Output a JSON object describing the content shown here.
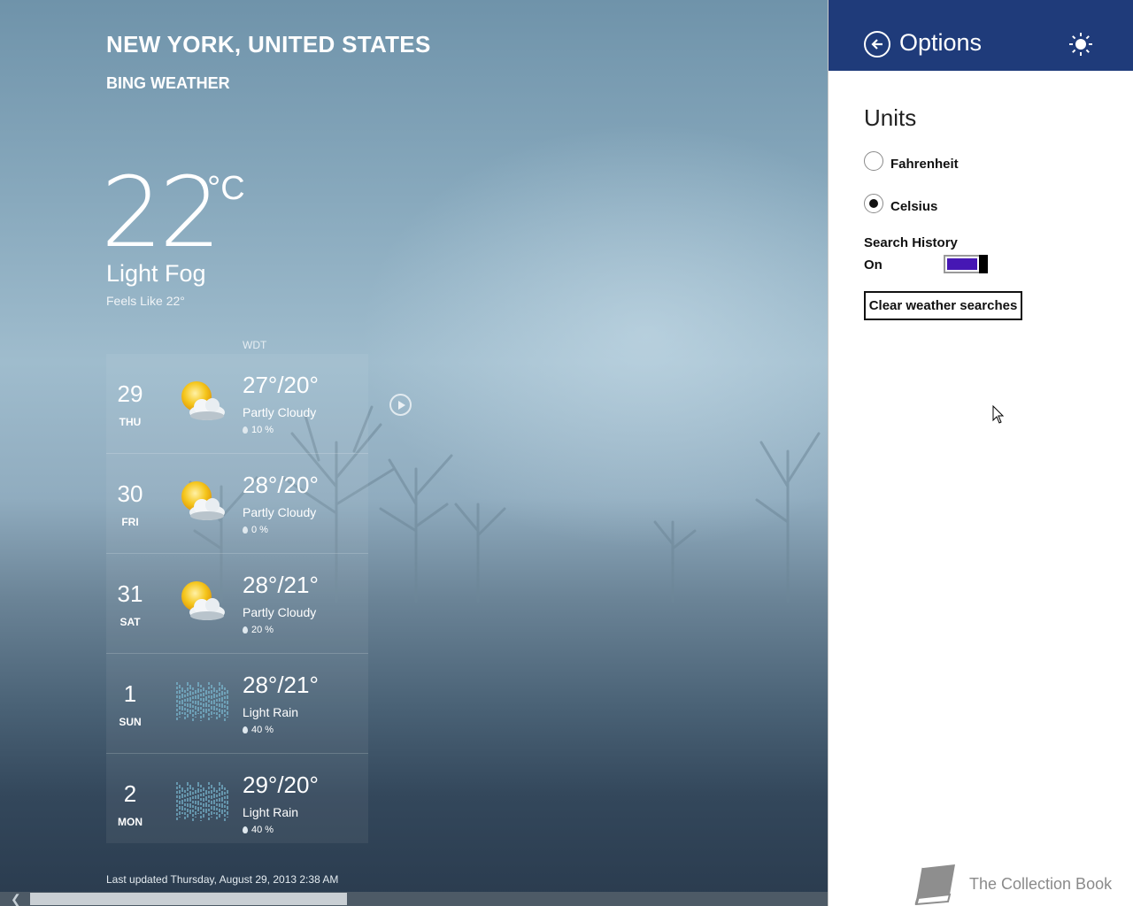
{
  "location": {
    "city": "NEW YORK, UNITED STATES",
    "provider": "BING WEATHER"
  },
  "current": {
    "temp": "22",
    "unit": "°C",
    "condition": "Light Fog",
    "feels_like": "Feels Like 22°"
  },
  "forecast_header": {
    "timezone": "WDT"
  },
  "forecast": [
    {
      "date": "29",
      "dow": "THU",
      "hilo": "27°/20°",
      "condition": "Partly Cloudy",
      "precip": "10 %",
      "icon": "partly-cloudy-icon"
    },
    {
      "date": "30",
      "dow": "FRI",
      "hilo": "28°/20°",
      "condition": "Partly Cloudy",
      "precip": "0 %",
      "icon": "partly-cloudy-icon"
    },
    {
      "date": "31",
      "dow": "SAT",
      "hilo": "28°/21°",
      "condition": "Partly Cloudy",
      "precip": "20 %",
      "icon": "partly-cloudy-icon"
    },
    {
      "date": "1",
      "dow": "SUN",
      "hilo": "28°/21°",
      "condition": "Light Rain",
      "precip": "40 %",
      "icon": "light-rain-icon"
    },
    {
      "date": "2",
      "dow": "MON",
      "hilo": "29°/20°",
      "condition": "Light Rain",
      "precip": "40 %",
      "icon": "light-rain-icon"
    }
  ],
  "footer": {
    "last_updated": "Last updated Thursday, August 29, 2013 2:38 AM",
    "scroll_position": 0.0
  },
  "options": {
    "title": "Options",
    "units_heading": "Units",
    "units": [
      {
        "label": "Fahrenheit",
        "selected": false
      },
      {
        "label": "Celsius",
        "selected": true
      }
    ],
    "search_history_label": "Search History",
    "search_history_state": "On",
    "search_history_on": true,
    "clear_button": "Clear weather searches"
  },
  "watermark": {
    "text": "The Collection Book"
  },
  "colors": {
    "options_header": "#1f3b7a",
    "toggle_fill": "#4617b4",
    "sun": "#f2c318",
    "rain": "#7fc3dc"
  }
}
